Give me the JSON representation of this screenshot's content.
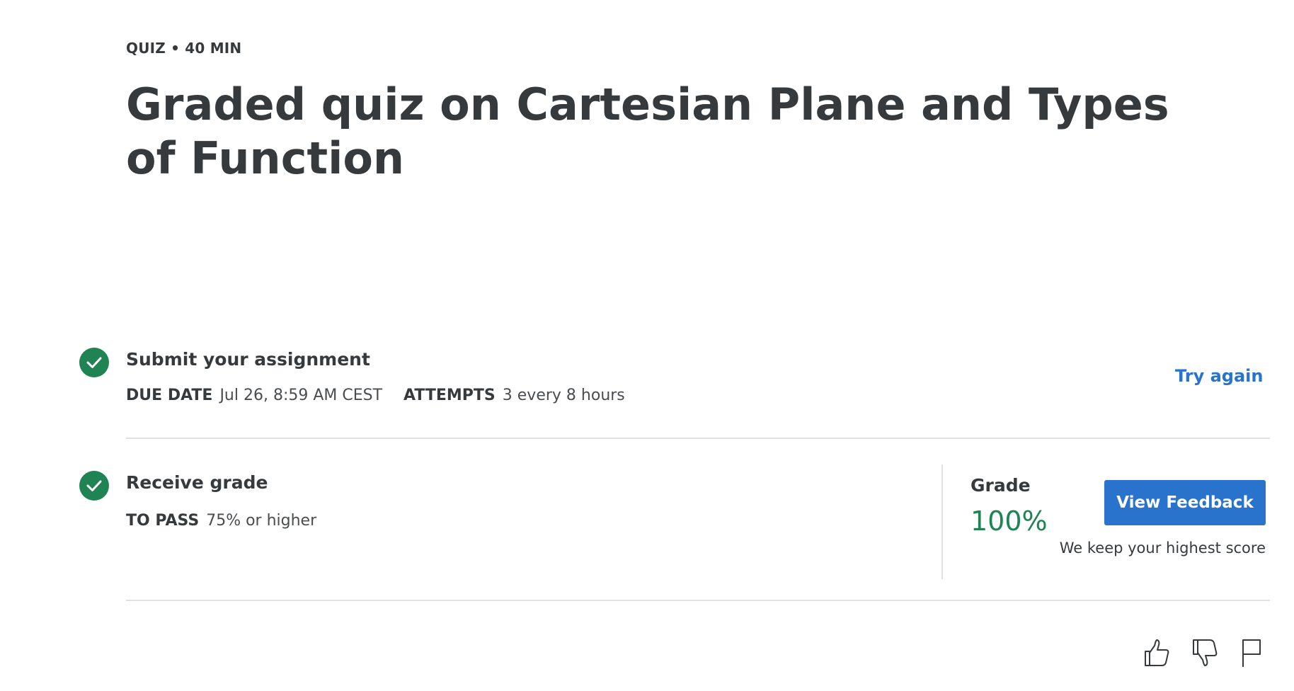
{
  "header": {
    "eyebrow": "QUIZ • 40 MIN",
    "title": "Graded quiz on Cartesian Plane and Types of Function"
  },
  "submit_step": {
    "title": "Submit your assignment",
    "due_label": "DUE DATE",
    "due_value": "Jul 26, 8:59 AM CEST",
    "attempts_label": "ATTEMPTS",
    "attempts_value": "3 every 8 hours",
    "action_label": "Try again",
    "status_icon": "check-circle-icon"
  },
  "grade_step": {
    "title": "Receive grade",
    "pass_label": "TO PASS",
    "pass_value": "75% or higher",
    "grade_label": "Grade",
    "grade_value": "100%",
    "button_label": "View Feedback",
    "note": "We keep your highest score",
    "status_icon": "check-circle-icon"
  },
  "footer_icons": [
    "thumbs-up-icon",
    "thumbs-down-icon",
    "flag-icon"
  ],
  "colors": {
    "accent_blue": "#2a73cc",
    "success_green": "#1f8354",
    "text_dark": "#373a3c",
    "divider": "#e0e0e0"
  }
}
